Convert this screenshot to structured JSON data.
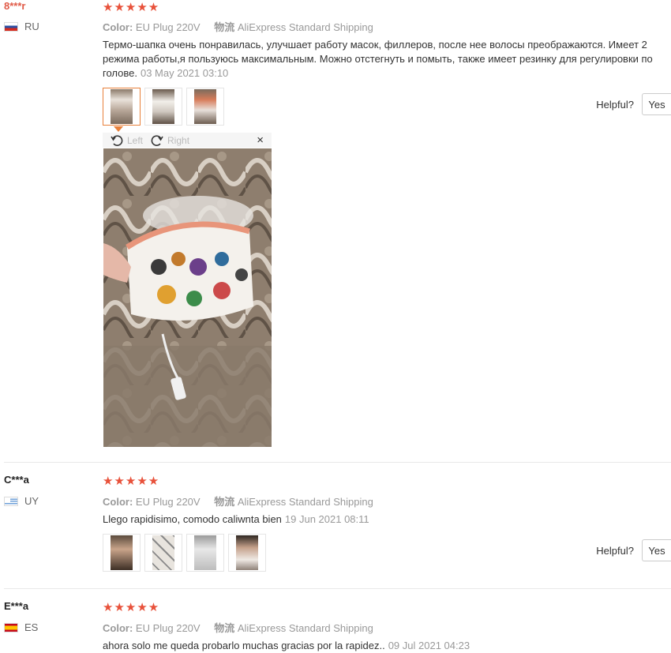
{
  "labels": {
    "color": "Color:",
    "shipping": "物流",
    "helpful": "Helpful?",
    "yes": "Yes"
  },
  "viewer": {
    "left": "Left",
    "right": "Right",
    "close": "×"
  },
  "reviews": [
    {
      "user": "8***r",
      "country": "RU",
      "stars": "★★★★★",
      "color_value": "EU Plug 220V",
      "shipping_value": "AliExpress Standard Shipping",
      "text": "Термо-шапка очень понравилась, улучшает работу масок, филлеров, после нее волосы преображаются. Имеет 2 режима работы,я пользуюсь максимальным. Можно отстегнуть и помыть, также имеет резинку для регулировки по голове.",
      "date": "03 May 2021 03:10"
    },
    {
      "user": "C***a",
      "country": "UY",
      "stars": "★★★★★",
      "color_value": "EU Plug 220V",
      "shipping_value": "AliExpress Standard Shipping",
      "text": "Llego rapidisimo, comodo caliwnta bien",
      "date": "19 Jun 2021 08:11"
    },
    {
      "user": "E***a",
      "country": "ES",
      "stars": "★★★★★",
      "color_value": "EU Plug 220V",
      "shipping_value": "AliExpress Standard Shipping",
      "text": "ahora solo me queda probarlo muchas gracias por la rapidez..",
      "date": "09 Jul 2021 04:23"
    }
  ]
}
